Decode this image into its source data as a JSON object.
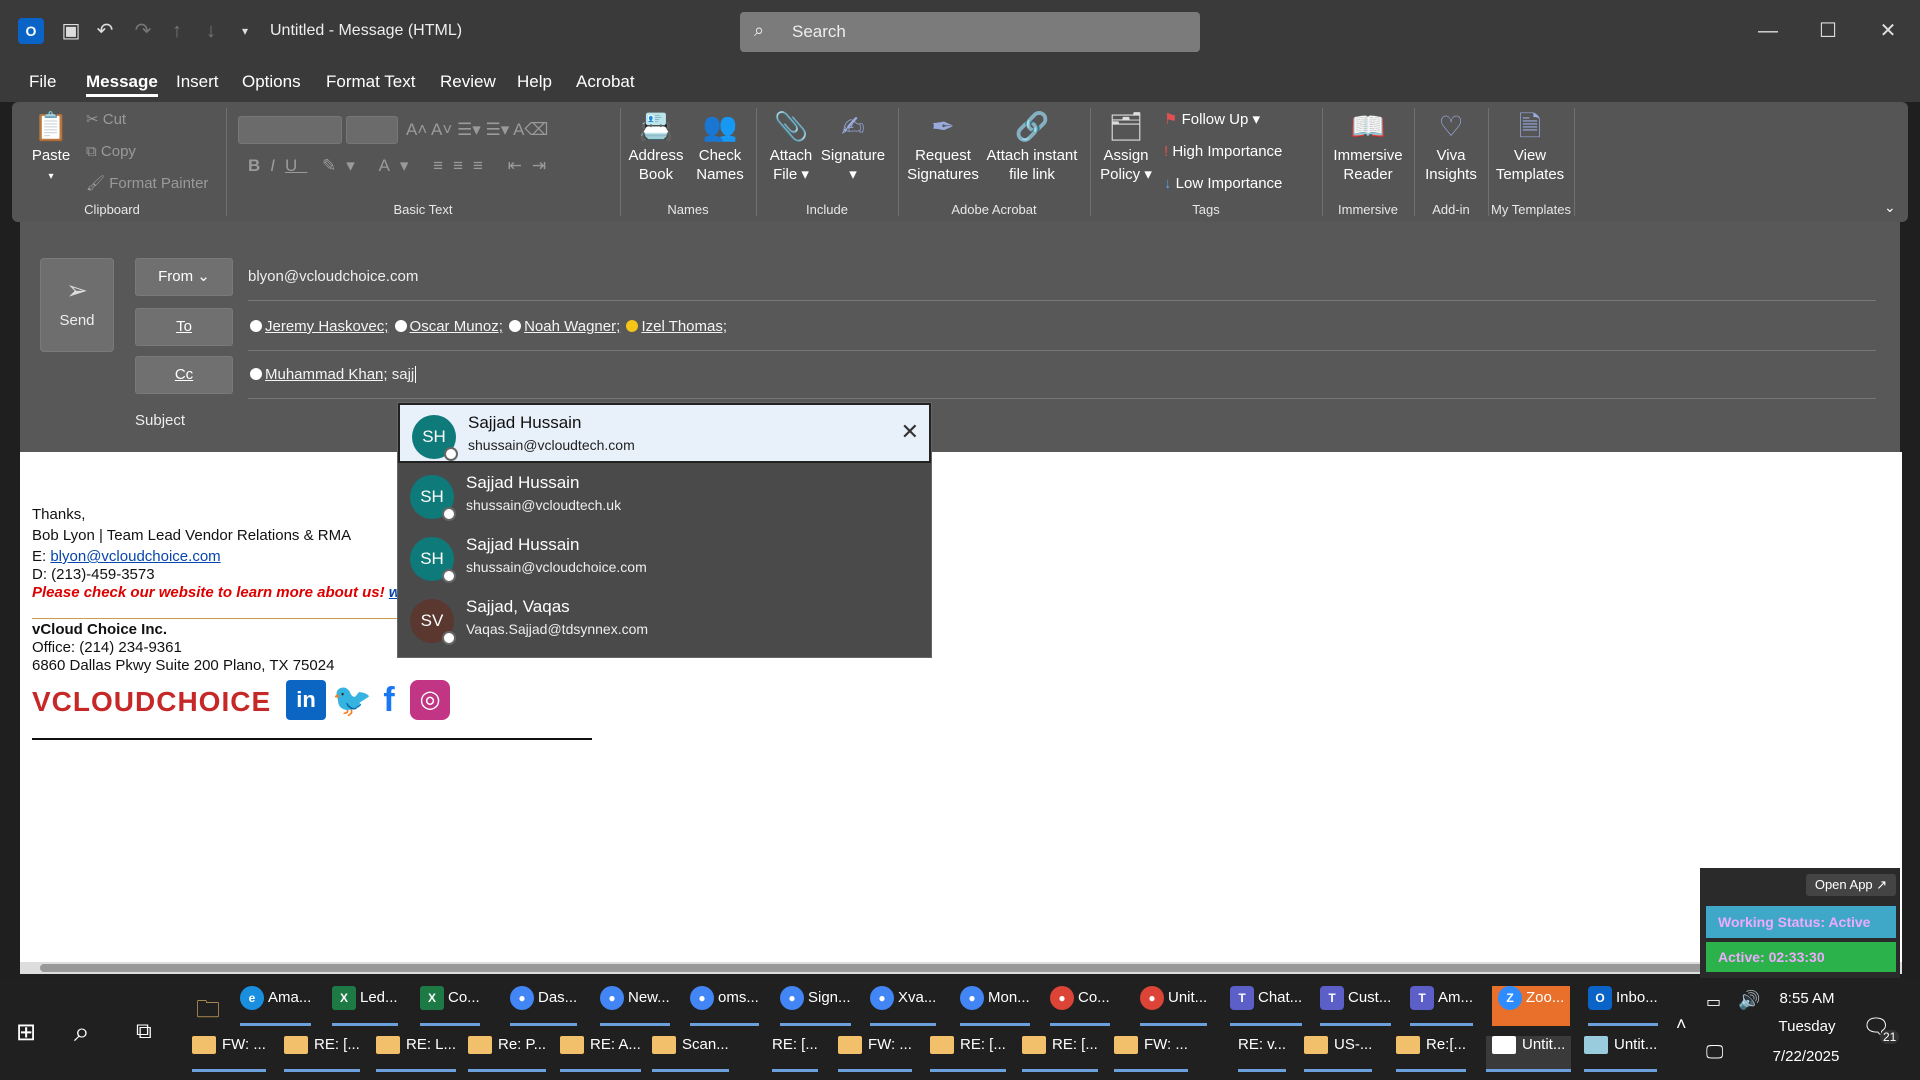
{
  "window": {
    "title": "Untitled  -  Message (HTML)",
    "search_placeholder": "Search"
  },
  "menu": [
    "File",
    "Message",
    "Insert",
    "Options",
    "Format Text",
    "Review",
    "Help",
    "Acrobat"
  ],
  "ribbon": {
    "paste": "Paste",
    "cut": "Cut",
    "copy": "Copy",
    "format_painter": "Format Painter",
    "clipboard": "Clipboard",
    "basic_text": "Basic Text",
    "address_book": [
      "Address",
      "Book"
    ],
    "check_names": [
      "Check",
      "Names"
    ],
    "names": "Names",
    "attach_file": [
      "Attach",
      "File"
    ],
    "signature": "Signature",
    "include": "Include",
    "request_signatures": [
      "Request",
      "Signatures"
    ],
    "attach_link": [
      "Attach instant",
      "file link"
    ],
    "adobe": "Adobe Acrobat",
    "assign_policy": [
      "Assign",
      "Policy"
    ],
    "follow_up": "Follow Up",
    "high_importance": "High Importance",
    "low_importance": "Low Importance",
    "tags": "Tags",
    "immersive_reader": [
      "Immersive",
      "Reader"
    ],
    "immersive": "Immersive",
    "viva": [
      "Viva",
      "Insights"
    ],
    "addin": "Add-in",
    "view_templates": [
      "View",
      "Templates"
    ],
    "my_templates": "My Templates"
  },
  "compose": {
    "send": "Send",
    "from_label": "From",
    "from_value": "blyon@vcloudchoice.com",
    "to_label": "To",
    "cc_label": "Cc",
    "subject_label": "Subject",
    "to": [
      "Jeremy Haskovec;",
      "Oscar Munoz;",
      "Noah Wagner;",
      "Izel Thomas;"
    ],
    "cc": [
      "Muhammad Khan;"
    ],
    "cc_typed": "sajj"
  },
  "autocomplete": [
    {
      "initials": "SH",
      "name": "Sajjad Hussain",
      "email": "shussain@vcloudtech.com"
    },
    {
      "initials": "SH",
      "name": "Sajjad Hussain",
      "email": "shussain@vcloudtech.uk"
    },
    {
      "initials": "SH",
      "name": "Sajjad Hussain",
      "email": "shussain@vcloudchoice.com"
    },
    {
      "initials": "SV",
      "name": "Sajjad, Vaqas",
      "email": "Vaqas.Sajjad@tdsynnex.com"
    }
  ],
  "signature": {
    "thanks": "Thanks,",
    "name_title": "Bob Lyon | Team Lead Vendor Relations & RMA",
    "e_label": "E: ",
    "email": "blyon@vcloudchoice.com",
    "phone": "D: (213)-459-3573",
    "promo": "Please check our website to learn more about us!",
    "promo_link": "w",
    "company": "vCloud Choice Inc.",
    "office": "Office: (214) 234-9361",
    "address": "6860 Dallas Pkwy Suite 200 Plano, TX 75024",
    "logo": "VCLOUDCHOICE"
  },
  "zoom": {
    "open_app": "Open App ↗",
    "status": "Working Status: Active",
    "active": "Active: 02:33:30"
  },
  "taskbar": {
    "row1": [
      "Ama...",
      "Led...",
      "Co...",
      "Das...",
      "New...",
      "oms...",
      "Sign...",
      "Xva...",
      "Mon...",
      "Co...",
      "Unit...",
      "Chat...",
      "Cust...",
      "Am...",
      "Zoo...",
      "Inbo..."
    ],
    "row2": [
      "FW: ...",
      "RE: [...",
      "RE: L...",
      "Re: P...",
      "RE: A...",
      "Scan...",
      "RE: [...",
      "FW: ...",
      "RE: [...",
      "RE: [...",
      "FW: ...",
      "RE: v...",
      "US-...",
      "Re:[...",
      "Untit...",
      "Untit..."
    ],
    "time": "8:55 AM",
    "day": "Tuesday",
    "date": "7/22/2025",
    "notif": "21"
  }
}
